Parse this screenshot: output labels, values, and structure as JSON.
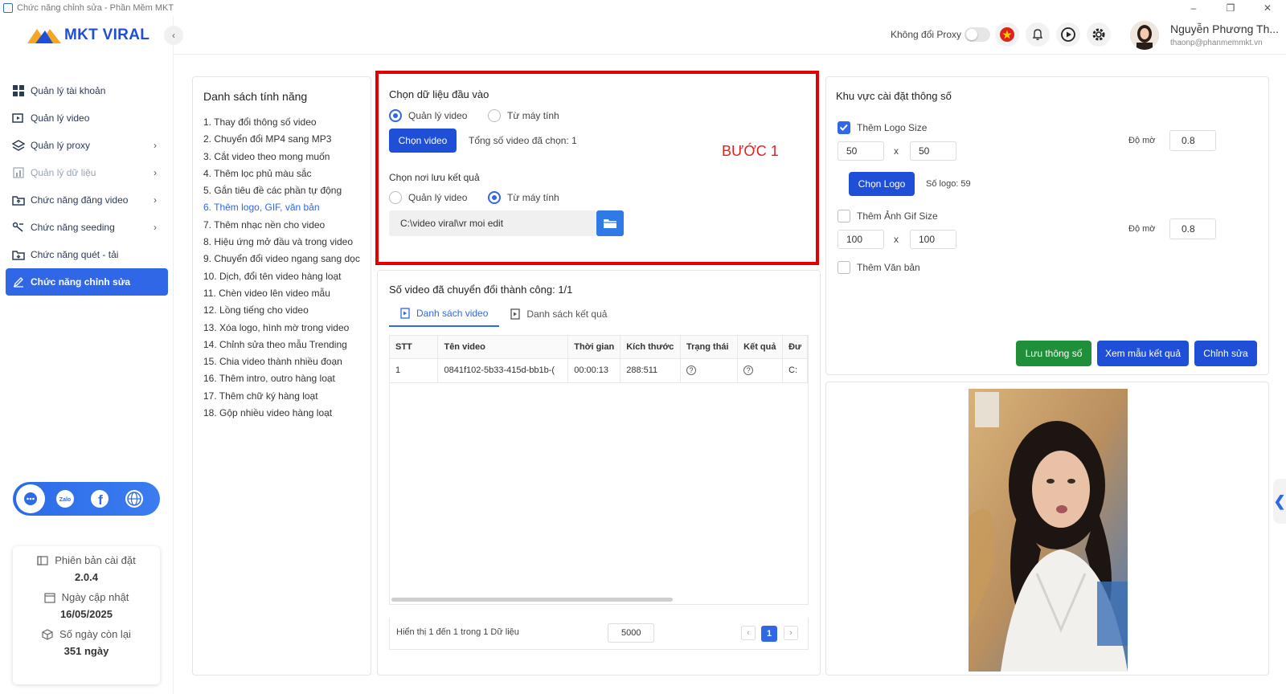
{
  "window": {
    "title": "Chức năng chỉnh sửa - Phần Mềm MKT"
  },
  "logo": {
    "text": "MKT VIRAL"
  },
  "sidebar": {
    "items": [
      {
        "label": "Quản lý tài khoản"
      },
      {
        "label": "Quản lý video"
      },
      {
        "label": "Quản lý proxy"
      },
      {
        "label": "Quản lý dữ liệu"
      },
      {
        "label": "Chức năng đăng video"
      },
      {
        "label": "Chức năng seeding"
      },
      {
        "label": "Chức năng quét - tải"
      },
      {
        "label": "Chức năng chỉnh sửa"
      }
    ]
  },
  "version": {
    "install_label": "Phiên bản cài đặt",
    "install_value": "2.0.4",
    "update_label": "Ngày cập nhật",
    "update_value": "16/05/2025",
    "days_label": "Số ngày còn lại",
    "days_value": "351 ngày"
  },
  "header": {
    "proxy_label": "Không đổi Proxy",
    "user_name": "Nguyễn Phương Th...",
    "user_email": "thaonp@phanmemmkt.vn"
  },
  "features": {
    "title": "Danh sách tính năng",
    "items": [
      "1. Thay đổi thông số video",
      "2. Chuyển đổi MP4 sang MP3",
      "3. Cắt video theo mong muốn",
      "4. Thêm lọc phủ màu sắc",
      "5. Gắn tiêu đề các phần tự động",
      "6. Thêm logo, GIF, văn bản",
      "7. Thêm nhạc nền cho video",
      "8. Hiệu ứng mở đầu và trong video",
      "9. Chuyển đổi video ngang sang dọc",
      "10. Dịch, đổi tên video hàng loạt",
      "11. Chèn video lên video mẫu",
      "12. Lồng tiếng cho video",
      "13. Xóa logo, hình mờ trong video",
      "14. Chỉnh sửa theo mẫu Trending",
      "15. Chia video thành nhiều đoạn",
      "16. Thêm intro, outro hàng loạt",
      "17. Thêm chữ ký hàng loạt",
      "18. Gộp nhiều video hàng loạt"
    ]
  },
  "input": {
    "title": "Chọn dữ liệu đầu vào",
    "opt_manage": "Quản lý video",
    "opt_computer": "Từ máy tính",
    "choose_btn": "Chọn video",
    "total_selected": "Tổng số video đã chọn: 1",
    "step_label": "BƯỚC 1",
    "save_title": "Chọn nơi lưu kết quả",
    "save_opt_manage": "Quản lý video",
    "save_opt_computer": "Từ máy tính",
    "path": "C:\\video viral\\vr moi edit"
  },
  "results": {
    "title": "Số video đã chuyển đổi thành công: 1/1",
    "tab_videos": "Danh sách video",
    "tab_results": "Danh sách kết quả",
    "columns": [
      "STT",
      "Tên video",
      "Thời gian",
      "Kích thước",
      "Trạng thái",
      "Kết quả",
      "Đư"
    ],
    "rows": [
      {
        "stt": "1",
        "name": "0841f102-5b33-415d-bb1b-(",
        "time": "00:00:13",
        "size": "288:511",
        "path": "C:"
      }
    ],
    "footer_text": "Hiển thị 1 đến 1 trong 1 Dữ liệu",
    "page_size": "5000",
    "page": "1"
  },
  "settings": {
    "title": "Khu vực cài đặt thông số",
    "logo_size_label": "Thêm Logo Size",
    "logo_w": "50",
    "logo_h": "50",
    "x": "x",
    "opacity_label": "Độ mờ",
    "logo_opacity": "0.8",
    "choose_logo_btn": "Chọn Logo",
    "logo_count": "Số logo: 59",
    "gif_label": "Thêm Ảnh Gif Size",
    "gif_w": "100",
    "gif_h": "100",
    "gif_opacity": "0.8",
    "text_label": "Thêm Văn bản",
    "save_btn": "Lưu thông số",
    "preview_btn": "Xem mẫu kết quả",
    "edit_btn": "Chỉnh sửa"
  }
}
